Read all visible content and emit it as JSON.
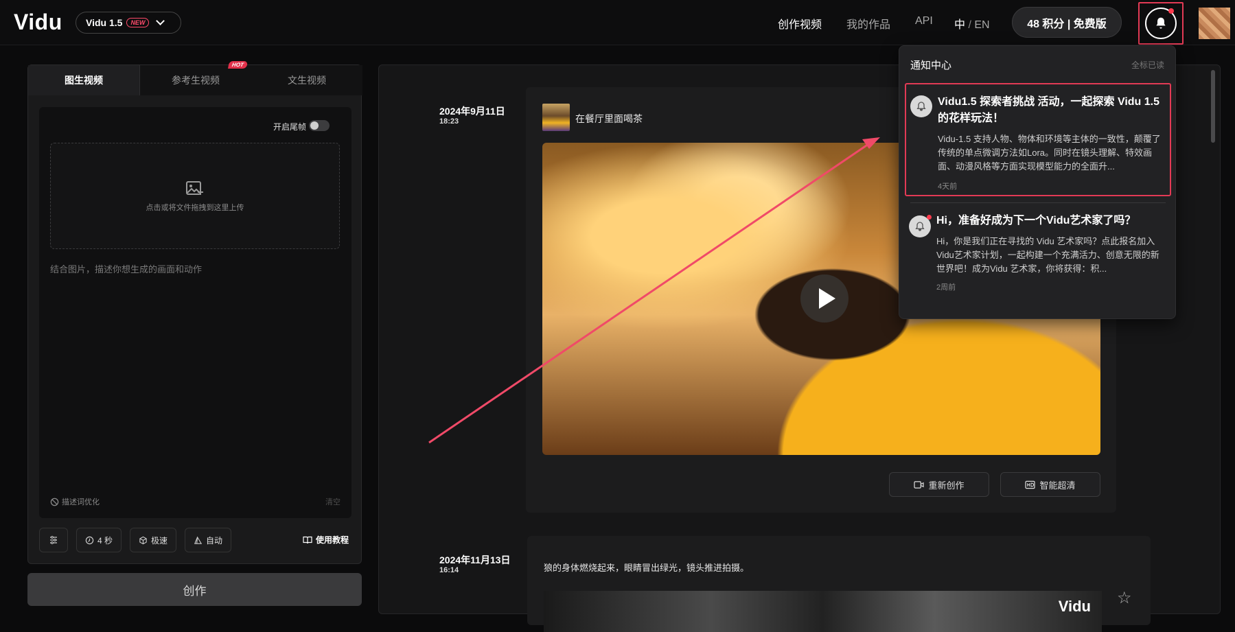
{
  "header": {
    "logo": "Vidu",
    "model": "Vidu 1.5",
    "model_badge": "NEW",
    "nav": [
      "创作视频",
      "我的作品",
      "API"
    ],
    "lang_zh": "中",
    "lang_sep": "/",
    "lang_en": "EN",
    "points": "48 积分 | 免费版"
  },
  "left": {
    "tabs": [
      "图生视频",
      "参考生视频",
      "文生视频"
    ],
    "hot_badge": "HOT",
    "toggle_label": "开启尾帧",
    "upload_hint": "点击或将文件拖拽到这里上传",
    "prompt_placeholder": "结合图片，描述你想生成的画面和动作",
    "optimize": "描述词优化",
    "clear": "清空",
    "options": [
      "4 秒",
      "极速",
      "自动"
    ],
    "tutorial": "使用教程",
    "create": "创作"
  },
  "feed": {
    "item1": {
      "date": "2024年9月11日",
      "time": "18:23",
      "prompt": "在餐厅里面喝茶",
      "recreate": "重新创作",
      "upscale": "智能超清"
    },
    "item2": {
      "date": "2024年11月13日",
      "time": "16:14",
      "prompt": "狼的身体燃烧起来，眼睛冒出绿光，镜头推进拍摄。",
      "watermark": "Vidu"
    }
  },
  "notifications": {
    "title": "通知中心",
    "mark_all_read": "全标已读",
    "items": [
      {
        "title": "Vidu1.5 探索者挑战 活动，一起探索 Vidu 1.5 的花样玩法！",
        "body": "Vidu-1.5 支持人物、物体和环境等主体的一致性，颠覆了传统的单点微调方法如Lora。同时在镜头理解、特效画面、动漫风格等方面实现模型能力的全面升...",
        "time": "4天前"
      },
      {
        "title": "Hi，准备好成为下一个Vidu艺术家了吗？",
        "body": "Hi，你是我们正在寻找的 Vidu 艺术家吗？点此报名加入Vidu艺术家计划，一起构建一个充满活力、创意无限的新世界吧！成为Vidu 艺术家，你将获得：积...",
        "time": "2周前"
      }
    ]
  },
  "colors": {
    "highlight": "#e33a55",
    "accent_dot": "#ff3b4e"
  }
}
